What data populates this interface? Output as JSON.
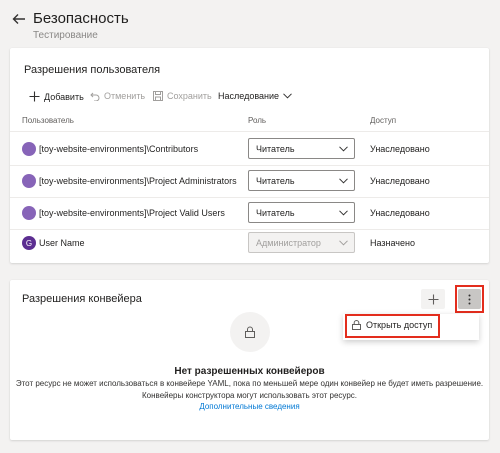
{
  "header": {
    "title": "Безопасность",
    "subtitle": "Тестирование"
  },
  "user_permissions": {
    "title": "Разрешения пользователя",
    "toolbar": {
      "add": "Добавить",
      "undo": "Отменить",
      "save": "Сохранить",
      "inheritance": "Наследование"
    },
    "columns": [
      "Пользователь",
      "Роль",
      "Доступ"
    ],
    "rows": [
      {
        "name": "[toy-website-environments]\\Contributors",
        "role": "Читатель",
        "access": "Унаследовано",
        "avatar": "group-icon"
      },
      {
        "name": "[toy-website-environments]\\Project Administrators",
        "role": "Читатель",
        "access": "Унаследовано",
        "avatar": "group-icon"
      },
      {
        "name": "[toy-website-environments]\\Project Valid Users",
        "role": "Читатель",
        "access": "Унаследовано",
        "avatar": "group-icon"
      },
      {
        "name": "User Name",
        "role": "Администратор",
        "access": "Назначено",
        "avatar_letter": "G"
      }
    ]
  },
  "pipeline_permissions": {
    "title": "Разрешения конвейера",
    "menu": {
      "open_access": "Открыть доступ"
    },
    "empty": {
      "title": "Нет разрешенных конвейеров",
      "line1": "Этот ресурс не может использоваться в конвейере YAML, пока по меньшей мере один конвейер не будет иметь разрешение.",
      "line2": "Конвейеры конструктора могут использовать этот ресурс.",
      "link": "Дополнительные сведения"
    }
  },
  "colors": {
    "accent": "#0078d4",
    "highlight": "#e32d1d",
    "group_avatar": "#8764b8",
    "user_avatar": "#5c2e91"
  }
}
